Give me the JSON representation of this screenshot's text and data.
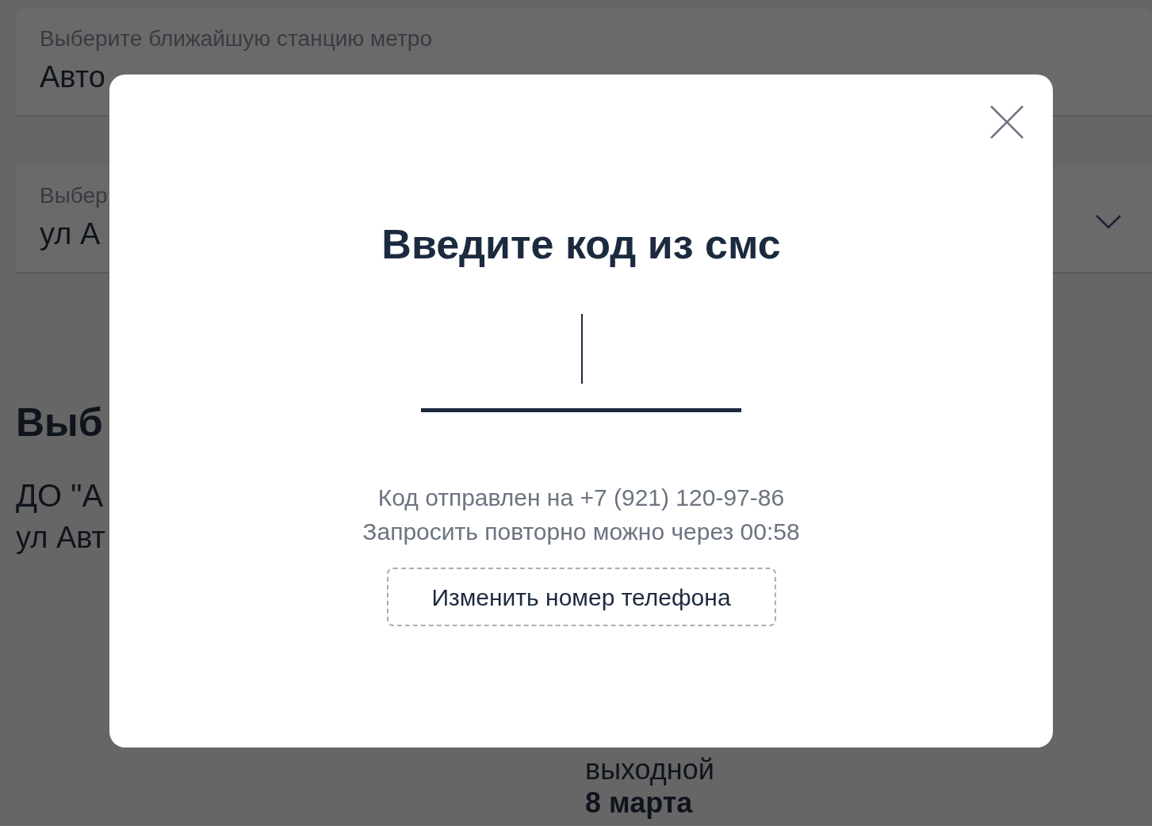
{
  "background": {
    "fields": [
      {
        "label": "Выберите ближайшую станцию метро",
        "value": "Авто",
        "dropdown": false
      },
      {
        "label": "Выбер",
        "value": "ул А",
        "dropdown": true
      }
    ],
    "heading": "Выб",
    "office_name": "ДО \"А",
    "office_address": "ул Авт",
    "schedule": [
      {
        "text": "выходной",
        "bold": false
      },
      {
        "text": "8 марта",
        "bold": true
      }
    ]
  },
  "modal": {
    "title": "Введите код из смс",
    "code_input": {
      "focused": true
    },
    "info_lines": [
      "Код отправлен на +7 (921) 120-97-86",
      "Запросить повторно можно через 00:58"
    ],
    "change_button": "Изменить номер телефона"
  }
}
